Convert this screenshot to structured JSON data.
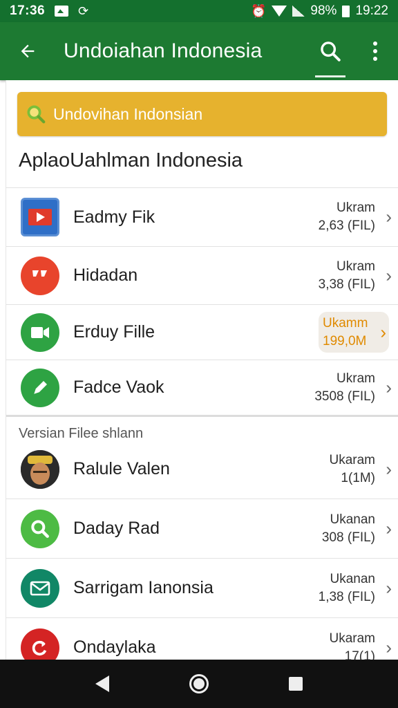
{
  "status_bar": {
    "time_left": "17:36",
    "battery": "98%",
    "time_right": "19:22"
  },
  "app_bar": {
    "title": "Undoiahan Indonesia",
    "back_icon": "arrow-left-icon",
    "search_icon": "search-icon",
    "overflow_icon": "more-vert-icon"
  },
  "banner": {
    "text": "Undovihan Indonsian",
    "icon": "search-icon",
    "color": "#e6b22e"
  },
  "section1": {
    "heading": "AplaoUahlman Indonesia",
    "items": [
      {
        "name": "Eadmy Fik",
        "size_label": "Ukram",
        "size": "2,63 (FIL)",
        "icon": "play-video-icon"
      },
      {
        "name": "Hidadan",
        "size_label": "Ukram",
        "size": "3,38 (FIL)",
        "icon": "chat-bubble-icon"
      },
      {
        "name": "Erduy Fille",
        "size_label": "Ukamm",
        "size": "199,0M",
        "icon": "video-camera-icon",
        "highlighted": true
      },
      {
        "name": "Fadce Vaok",
        "size_label": "Ukram",
        "size": "3508 (FIL)",
        "icon": "pencil-icon"
      }
    ]
  },
  "section2": {
    "heading": "Versian Filee shlann",
    "items": [
      {
        "name": "Ralule Valen",
        "size_label": "Ukaram",
        "size": "1(1M)",
        "icon": "avatar-icon"
      },
      {
        "name": "Daday Rad",
        "size_label": "Ukanan",
        "size": "308 (FIL)",
        "icon": "search-icon"
      },
      {
        "name": "Sarrigam Ianonsia",
        "size_label": "Ukanan",
        "size": "1,38 (FIL)",
        "icon": "mail-icon"
      },
      {
        "name": "Ondaylaka",
        "size_label": "Ukaram",
        "size": "17(1)",
        "icon": "refresh-icon"
      }
    ]
  },
  "nav_bar": {
    "back_icon": "nav-back-icon",
    "home_icon": "nav-home-icon",
    "recents_icon": "nav-recents-icon"
  },
  "colors": {
    "status_bar": "#14702e",
    "app_bar": "#1d7a32",
    "highlight_text": "#e08a00"
  }
}
